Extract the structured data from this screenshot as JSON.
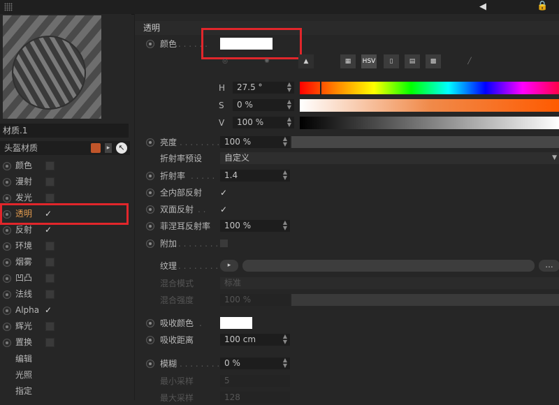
{
  "left": {
    "material_name": "材质.1",
    "head_label": "头盔材质",
    "channels": [
      {
        "label": "颜色",
        "checked": false
      },
      {
        "label": "漫射",
        "checked": false
      },
      {
        "label": "发光",
        "checked": false
      },
      {
        "label": "透明",
        "checked": true
      },
      {
        "label": "反射",
        "checked": true
      },
      {
        "label": "环境",
        "checked": false
      },
      {
        "label": "烟雾",
        "checked": false
      },
      {
        "label": "凹凸",
        "checked": false
      },
      {
        "label": "法线",
        "checked": false
      },
      {
        "label": "Alpha",
        "checked": true
      },
      {
        "label": "辉光",
        "checked": false
      },
      {
        "label": "置换",
        "checked": false
      }
    ],
    "extras": [
      "编辑",
      "光照",
      "指定"
    ],
    "check_mark": "✓"
  },
  "right": {
    "section_title": "透明",
    "color_label": "颜色",
    "color_swatch": "#ffffff",
    "mode_buttons": [
      "HSV"
    ],
    "h_label": "H",
    "h_value": "27.5 °",
    "s_label": "S",
    "s_value": "0 %",
    "v_label": "V",
    "v_value": "100 %",
    "brightness_label": "亮度",
    "brightness_value": "100 %",
    "ior_preset_label": "折射率预设",
    "ior_preset_value": "自定义",
    "ior_label": "折射率",
    "ior_value": "1.4",
    "total_internal_label": "全内部反射",
    "double_sided_label": "双面反射",
    "fresnel_label": "菲涅耳反射率",
    "fresnel_value": "100 %",
    "additive_label": "附加",
    "texture_label": "纹理",
    "texture_more": "...",
    "blend_mode_label": "混合模式",
    "blend_mode_value": "标准",
    "blend_strength_label": "混合强度",
    "blend_strength_value": "100 %",
    "absorb_color_label": "吸收颜色",
    "absorb_distance_label": "吸收距离",
    "absorb_distance_value": "100 cm",
    "blur_label": "模糊",
    "blur_value": "0 %",
    "min_samples_label": "最小采样",
    "min_samples_value": "5",
    "max_samples_label": "最大采样",
    "max_samples_value": "128",
    "check_mark": "✓"
  },
  "colors": {
    "highlight_red": "#e1262b",
    "active_label": "#e09a4e"
  }
}
